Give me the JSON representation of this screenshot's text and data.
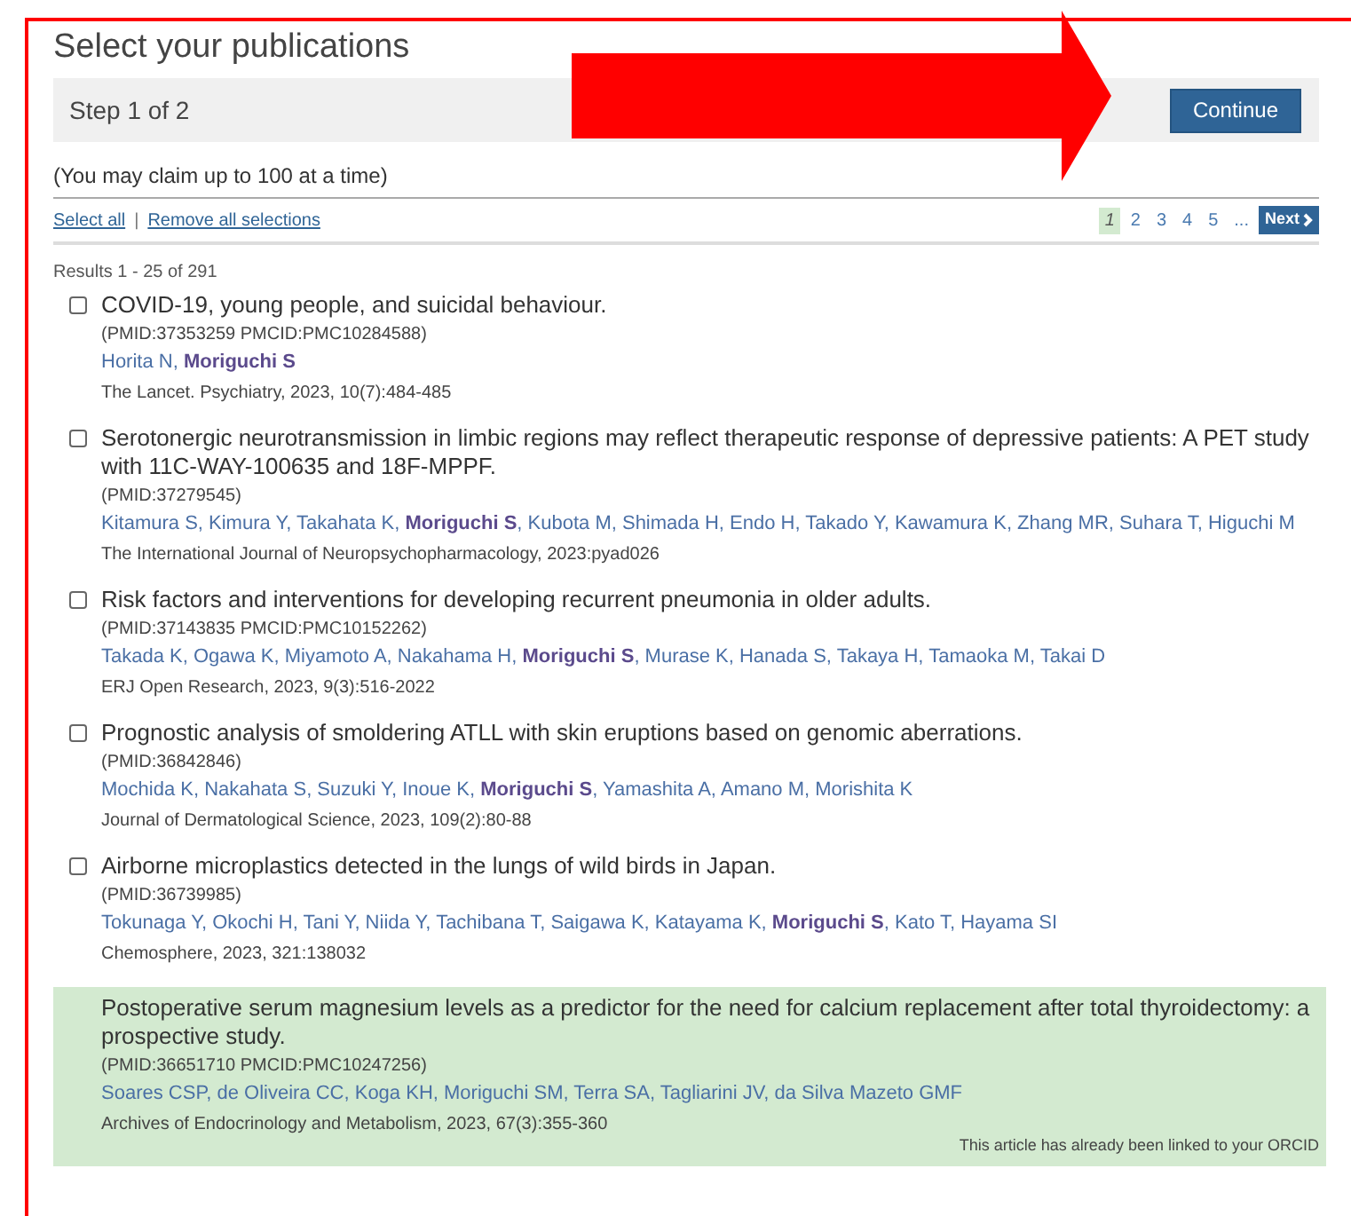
{
  "title": "Select your publications",
  "step_bar": {
    "step": "Step 1 of 2",
    "button": "Continue"
  },
  "claim_note": "(You may claim up to 100 at a time)",
  "actions": [
    "Select all",
    "Remove all selections"
  ],
  "actions_separator": "|",
  "pagination": {
    "pages": [
      {
        "label": "1",
        "selected": true
      },
      {
        "label": "2",
        "selected": false
      },
      {
        "label": "3",
        "selected": false
      },
      {
        "label": "4",
        "selected": false
      },
      {
        "label": "5",
        "selected": false
      }
    ],
    "ellipsis": "...",
    "next": "Next"
  },
  "results_count": "Results 1 - 25 of 291",
  "publications": [
    {
      "kind": "selectable",
      "checked": false,
      "title": "COVID-19, young people, and suicidal behaviour.",
      "ids": "(PMID:37353259 PMCID:PMC10284588)",
      "authors": "Horita N, **Moriguchi S**",
      "source": "The Lancet. Psychiatry, 2023, 10(7):484-485"
    },
    {
      "kind": "selectable",
      "checked": false,
      "title": "Serotonergic neurotransmission in limbic regions may reflect therapeutic response of depressive patients: A PET study with 11C-WAY-100635 and 18F-MPPF.",
      "ids": "(PMID:37279545)",
      "authors": "Kitamura S, Kimura Y, Takahata K, **Moriguchi S**, Kubota M, Shimada H, Endo H, Takado Y, Kawamura K, Zhang MR, Suhara T, Higuchi M",
      "source": "The International Journal of Neuropsychopharmacology, 2023:pyad026"
    },
    {
      "kind": "selectable",
      "checked": false,
      "title": "Risk factors and interventions for developing recurrent pneumonia in older adults.",
      "ids": "(PMID:37143835 PMCID:PMC10152262)",
      "authors": "Takada K, Ogawa K, Miyamoto A, Nakahama H, **Moriguchi S**, Murase K, Hanada S, Takaya H, Tamaoka M, Takai D",
      "source": "ERJ Open Research, 2023, 9(3):516-2022"
    },
    {
      "kind": "selectable",
      "checked": false,
      "title": "Prognostic analysis of smoldering ATLL with skin eruptions based on genomic aberrations.",
      "ids": "(PMID:36842846)",
      "authors": "Mochida K, Nakahata S, Suzuki Y, Inoue K, **Moriguchi S**, Yamashita A, Amano M, Morishita K",
      "source": "Journal of Dermatological Science, 2023, 109(2):80-88"
    },
    {
      "kind": "selectable",
      "checked": false,
      "title": "Airborne microplastics detected in the lungs of wild birds in Japan.",
      "ids": "(PMID:36739985)",
      "authors": "Tokunaga Y, Okochi H, Tani Y, Niida Y, Tachibana T, Saigawa K, Katayama K, **Moriguchi S**, Kato T, Hayama SI",
      "source": "Chemosphere, 2023, 321:138032"
    },
    {
      "kind": "claimed",
      "title": "Postoperative serum magnesium levels as a predictor for the need for calcium replacement after total thyroidectomy: a prospective study.",
      "ids": "(PMID:36651710 PMCID:PMC10247256)",
      "authors": "Soares CSP, de Oliveira CC, Koga KH, Moriguchi SM, Terra SA, Tagliarini JV, da Silva Mazeto GMF",
      "source": "Archives of Endocrinology and Metabolism, 2023, 67(3):355-360",
      "note": "This article has already been linked to your ORCID"
    }
  ]
}
